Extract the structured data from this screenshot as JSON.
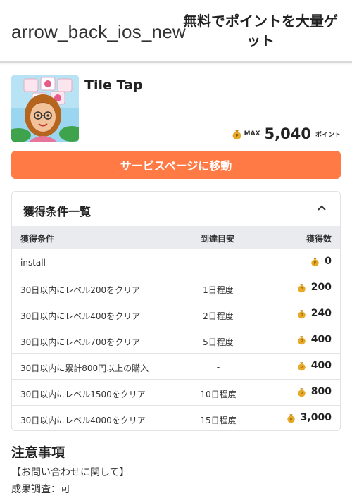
{
  "header": {
    "back_icon_text": "arrow_back_ios_new",
    "title": "無料でポイントを大量ゲット"
  },
  "app": {
    "name": "Tile Tap",
    "max_label": "MAX",
    "max_value": "5,040",
    "max_unit": "ポイント"
  },
  "cta": {
    "label": "サービスページに移動"
  },
  "conditions": {
    "title": "獲得条件一覧",
    "columns": [
      "獲得条件",
      "到達目安",
      "獲得数"
    ],
    "rows": [
      {
        "condition": "install",
        "eta": "",
        "points": "0"
      },
      {
        "condition": "30日以内にレベル200をクリア",
        "eta": "1日程度",
        "points": "200"
      },
      {
        "condition": "30日以内にレベル400をクリア",
        "eta": "2日程度",
        "points": "240"
      },
      {
        "condition": "30日以内にレベル700をクリア",
        "eta": "5日程度",
        "points": "400"
      },
      {
        "condition": "30日以内に累計800円以上の購入",
        "eta": "-",
        "points": "400"
      },
      {
        "condition": "30日以内にレベル1500をクリア",
        "eta": "10日程度",
        "points": "800"
      },
      {
        "condition": "30日以内にレベル4000をクリア",
        "eta": "15日程度",
        "points": "3,000"
      }
    ]
  },
  "notes": {
    "title": "注意事項",
    "line1": "【お問い合わせに関して】",
    "line2": "成果調査：可"
  },
  "colors": {
    "accent": "#ff7a45",
    "table_header": "#e9ebef",
    "coin": "#d99a1e"
  }
}
